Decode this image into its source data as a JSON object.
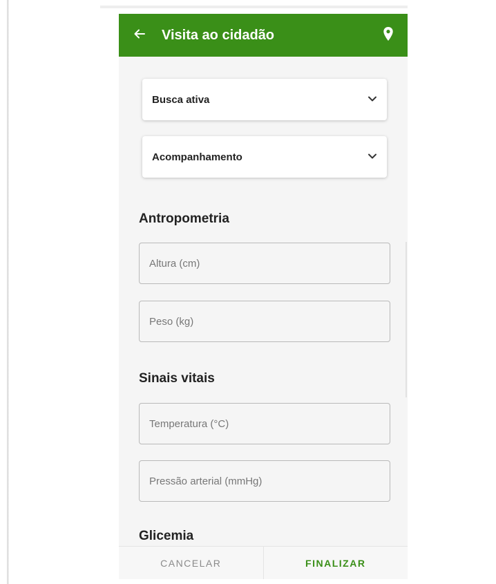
{
  "appbar": {
    "title": "Visita ao cidadão",
    "back_icon": "arrow-left-icon",
    "location_icon": "location-pin-icon",
    "color": "#3a8f18"
  },
  "selects": [
    {
      "value": "Busca ativa",
      "icon": "chevron-down-icon"
    },
    {
      "value": "Acompanhamento",
      "icon": "chevron-down-icon"
    }
  ],
  "sections": {
    "antropometria": {
      "title": "Antropometria",
      "fields": [
        {
          "placeholder": "Altura (cm)",
          "value": ""
        },
        {
          "placeholder": "Peso (kg)",
          "value": ""
        }
      ]
    },
    "sinais_vitais": {
      "title": "Sinais vitais",
      "fields": [
        {
          "placeholder": "Temperatura (°C)",
          "value": ""
        },
        {
          "placeholder": "Pressão arterial (mmHg)",
          "value": ""
        }
      ]
    },
    "glicemia": {
      "title": "Glicemia"
    }
  },
  "bottom_bar": {
    "cancel_label": "CANCELAR",
    "finish_label": "FINALIZAR"
  }
}
